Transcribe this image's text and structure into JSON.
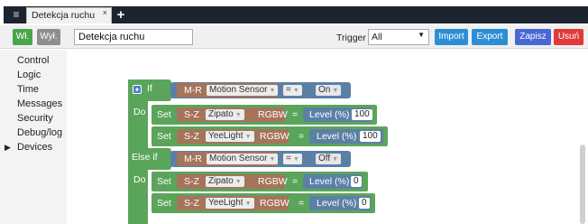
{
  "tabbar": {
    "menu_icon": "hamburger-menu-icon",
    "tab_label": "Detekcja ruchu",
    "tab_close": "×",
    "add_tab": "+"
  },
  "toolbar": {
    "on_label": "Wł.",
    "off_label": "Wył.",
    "scene_name": "Detekcja ruchu",
    "trigger_label": "Trigger",
    "trigger_value": "All",
    "import_label": "Import",
    "export_label": "Export",
    "save_label": "Zapisz",
    "delete_label": "Usuń"
  },
  "sidebar": {
    "items": [
      {
        "label": "Control"
      },
      {
        "label": "Logic"
      },
      {
        "label": "Time"
      },
      {
        "label": "Messages"
      },
      {
        "label": "Security"
      },
      {
        "label": "Debug/log"
      },
      {
        "label": "Devices",
        "arrow": "▶"
      }
    ]
  },
  "blocks": {
    "if_label": "If",
    "do_label": "Do",
    "else_if_label": "Else if",
    "set_label": "Set",
    "eq_label": "=",
    "cond1": {
      "prefix": "M-R",
      "sensor": "Motion Sensor",
      "op": "=",
      "value": "On"
    },
    "cond2": {
      "prefix": "M-R",
      "sensor": "Motion Sensor",
      "op": "=",
      "value": "Off"
    },
    "actions": [
      {
        "prefix": "S-Z",
        "device": "Zipato",
        "type": "RGBW",
        "param": "Level (%)",
        "value": "100"
      },
      {
        "prefix": "S-Z",
        "device": "YeeLight",
        "type": "RGBW",
        "param": "Level (%)",
        "value": "100"
      },
      {
        "prefix": "S-Z",
        "device": "Zipato",
        "type": "RGBW",
        "param": "Level (%)",
        "value": "0"
      },
      {
        "prefix": "S-Z",
        "device": "YeeLight",
        "type": "RGBW",
        "param": "Level (%)",
        "value": "0"
      }
    ]
  },
  "colors": {
    "logic_green": "#5ba55b",
    "compare_blue": "#5b80a5",
    "sensor_brown": "#a5745b",
    "import_blue": "#2c8fd6",
    "save_blue": "#4a67d6",
    "delete_red": "#e03a3a",
    "on_green": "#4aa64a"
  }
}
